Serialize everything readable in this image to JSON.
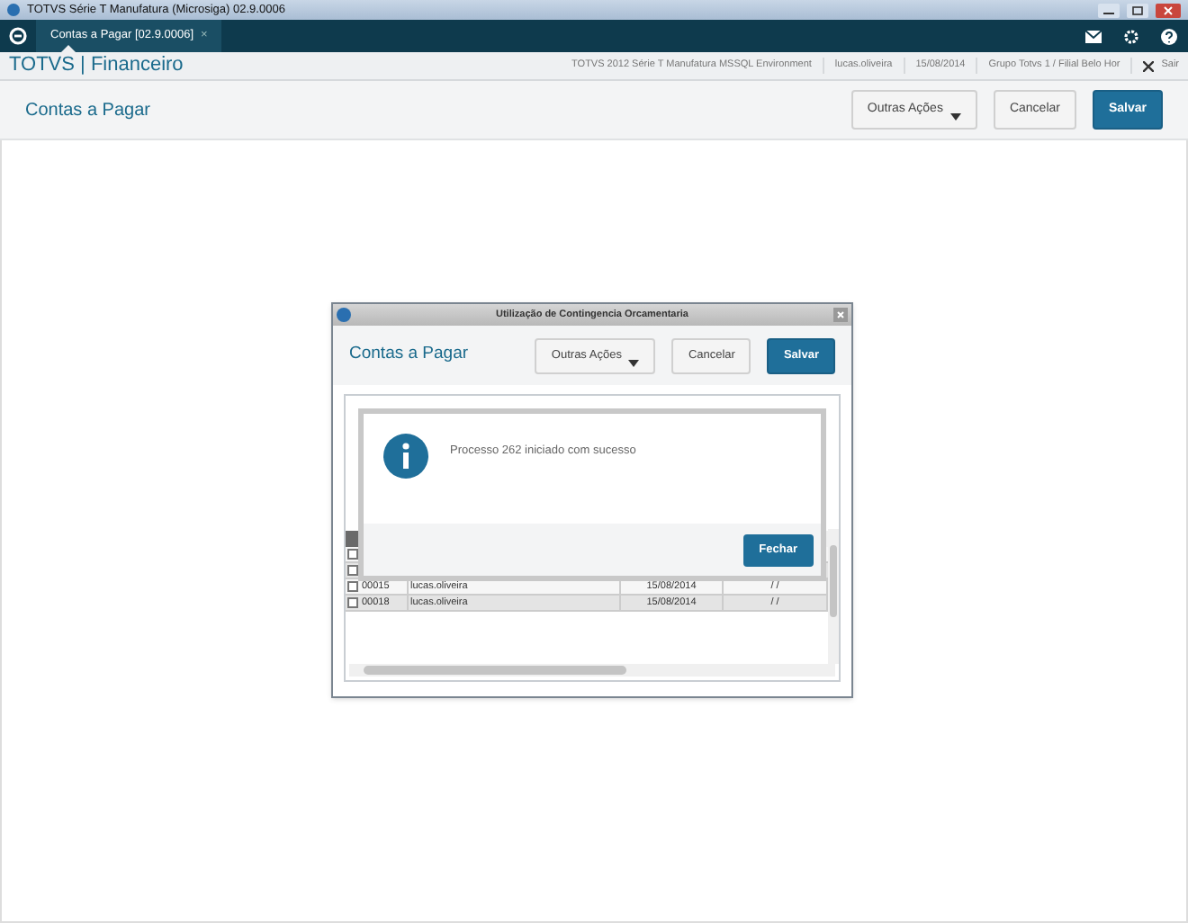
{
  "app_window": {
    "title": "TOTVS Série T Manufatura (Microsiga) 02.9.0006"
  },
  "tabs": [
    {
      "label": "Contas a Pagar [02.9.0006]",
      "selected": true,
      "close": "×"
    }
  ],
  "header": {
    "brand": "TOTVS | Financeiro",
    "info": [
      "TOTVS 2012 Série T Manufatura MSSQL Environment",
      "lucas.oliveira",
      "15/08/2014",
      "Grupo Totvs 1 / Filial Belo Hor"
    ],
    "exit": "Sair"
  },
  "page": {
    "title": "Contas a Pagar",
    "buttons": [
      {
        "label": "Outras Ações",
        "kind": "menu"
      },
      {
        "label": "Cancelar",
        "kind": "secondary"
      },
      {
        "label": "Salvar",
        "kind": "primary"
      }
    ]
  },
  "dialog": {
    "title": "Utilização de Contingencia Orcamentaria",
    "heading": "Contas a Pagar",
    "buttons": [
      {
        "label": "Outras Ações",
        "kind": "menu"
      },
      {
        "label": "Cancelar",
        "kind": "secondary"
      },
      {
        "label": "Salvar",
        "kind": "primary"
      }
    ],
    "rows": [
      {
        "checked": false
      },
      {
        "checked": false
      },
      {
        "checked": false,
        "cells": [
          "00015",
          "lucas.oliveira",
          "15/08/2014",
          "/ /"
        ]
      },
      {
        "checked": false,
        "cells": [
          "00018",
          "lucas.oliveira",
          "15/08/2014",
          "/ /"
        ]
      }
    ]
  },
  "message": {
    "text": "Processo 262 iniciado com sucesso",
    "button": "Fechar"
  }
}
